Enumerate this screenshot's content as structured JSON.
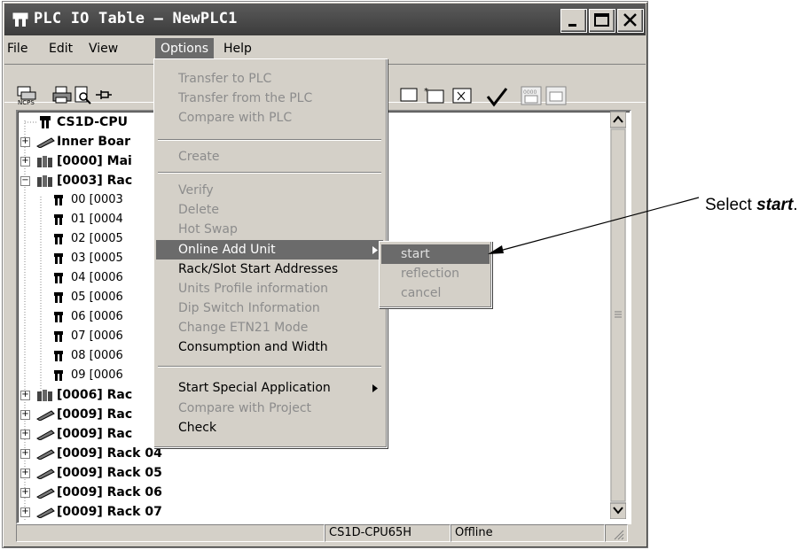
{
  "window": {
    "title": "PLC IO Table – NewPLC1"
  },
  "menubar": [
    "File",
    "Edit",
    "View",
    "Options",
    "Help"
  ],
  "tree": {
    "rows": [
      {
        "label": "CS1D-CPU"
      },
      {
        "label": "Inner Boar"
      },
      {
        "label": "[0000] Mai"
      },
      {
        "label": "[0003] Rac"
      },
      {
        "label": "00 [0003"
      },
      {
        "label": "01 [0004"
      },
      {
        "label": "02 [0005"
      },
      {
        "label": "03 [0005"
      },
      {
        "label": "04 [0006"
      },
      {
        "label": "05 [0006"
      },
      {
        "label": "06 [0006"
      },
      {
        "label": "07 [0006"
      },
      {
        "label": "08 [0006"
      },
      {
        "label": "09 [0006"
      },
      {
        "label": "[0006] Rac"
      },
      {
        "label": "[0009] Rac"
      },
      {
        "label": "[0009] Rac"
      },
      {
        "label": "[0009] Rack 04"
      },
      {
        "label": "[0009] Rack 05"
      },
      {
        "label": "[0009] Rack 06"
      },
      {
        "label": "[0009] Rack 07"
      }
    ]
  },
  "options_menu": {
    "items": [
      {
        "label": "Transfer to PLC",
        "enabled": false
      },
      {
        "label": "Transfer from the PLC",
        "enabled": false
      },
      {
        "label": "Compare with PLC",
        "enabled": false
      },
      {
        "label": "Create",
        "enabled": false
      },
      {
        "label": "Verify",
        "enabled": false
      },
      {
        "label": "Delete",
        "enabled": false
      },
      {
        "label": "Hot Swap",
        "enabled": false
      },
      {
        "label": "Online Add Unit",
        "enabled": true,
        "highlighted": true
      },
      {
        "label": "Rack/Slot Start Addresses",
        "enabled": true
      },
      {
        "label": "Units Profile information",
        "enabled": false
      },
      {
        "label": "Dip Switch Information",
        "enabled": false
      },
      {
        "label": "Change ETN21 Mode",
        "enabled": false
      },
      {
        "label": "Consumption and Width",
        "enabled": true
      },
      {
        "label": "Start Special Application",
        "enabled": true
      },
      {
        "label": "Compare with Project",
        "enabled": false
      },
      {
        "label": "Check",
        "enabled": true
      }
    ]
  },
  "submenu": {
    "items": [
      {
        "label": "start",
        "highlighted": true
      },
      {
        "label": "reflection"
      },
      {
        "label": "cancel"
      }
    ]
  },
  "status": {
    "cpu": "CS1D-CPU65H",
    "mode": "Offline"
  },
  "callout": {
    "prefix": "Select ",
    "emphasis": "start",
    "suffix": "."
  },
  "colors": {
    "highlight": "#6b6b6b",
    "disabled_text": "#8c8c8c",
    "face": "#d4d0c8"
  }
}
